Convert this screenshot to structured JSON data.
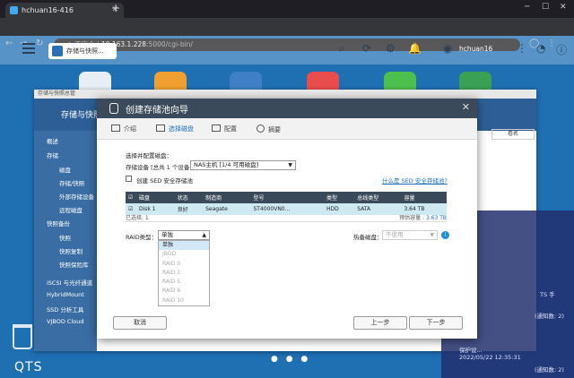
{
  "browser": {
    "tab_title": "hchuan16-416",
    "url_insecure": "不安全",
    "url_host": "10.163.1.228",
    "url_path": ":5000/cgi-bin/"
  },
  "qts": {
    "app_tab": "存储与快照...",
    "username": "hchuan16",
    "logo": "QTS",
    "user_sub": "adm..."
  },
  "bg_window": {
    "title": "存储与快照总管",
    "header": "存储与快照",
    "sidebar": [
      "概述",
      "存储",
      "磁盘",
      "存储/快照",
      "外部存储设备",
      "远程磁盘",
      "快照备份",
      "快照",
      "快照复制",
      "快照保险库",
      "iSCSI 与光纤通道",
      "HybridMount",
      "SSD 分析工具",
      "VJBOD Cloud"
    ],
    "right_tab": "卷名"
  },
  "tray": {
    "lines": [
      "TS 手",
      "(通知数: 2)",
      "保护设...",
      "2022/05/22 12:35:31",
      "(通知数: 2)"
    ]
  },
  "dialog": {
    "title": "创建存储池向导",
    "steps": [
      "介绍",
      "选择磁盘",
      "配置",
      "摘要"
    ],
    "select_label": "选择并配置磁盘：",
    "enclosure_label": "存储设备 [总共 1 个设备]:",
    "enclosure_value": "NAS主机 [1/4 可用磁盘]",
    "sed_label": "创建 SED 安全存储池",
    "sed_link": "什么是 SED 安全存储池?",
    "table": {
      "headers": [
        "磁盘",
        "状态",
        "制造商",
        "型号",
        "类型",
        "总线类型",
        "容量"
      ],
      "rows": [
        [
          "Disk 1",
          "良好",
          "Seagate",
          "ST4000VN0...",
          "HDD",
          "SATA",
          "3.64 TB"
        ]
      ]
    },
    "selected_text": "已选择: 1",
    "capacity_label": "预估容量 :",
    "capacity_value": "3.63 TB",
    "raid_label": "RAID类型：",
    "raid_value": "单独",
    "raid_options": [
      "单独",
      "JBOD",
      "RAID 0",
      "RAID 1",
      "RAID 5",
      "RAID 6",
      "RAID 10"
    ],
    "hotspare_label": "热备磁盘：",
    "hotspare_value": "不使用",
    "btn_cancel": "取消",
    "btn_prev": "上一步",
    "btn_next": "下一步"
  }
}
